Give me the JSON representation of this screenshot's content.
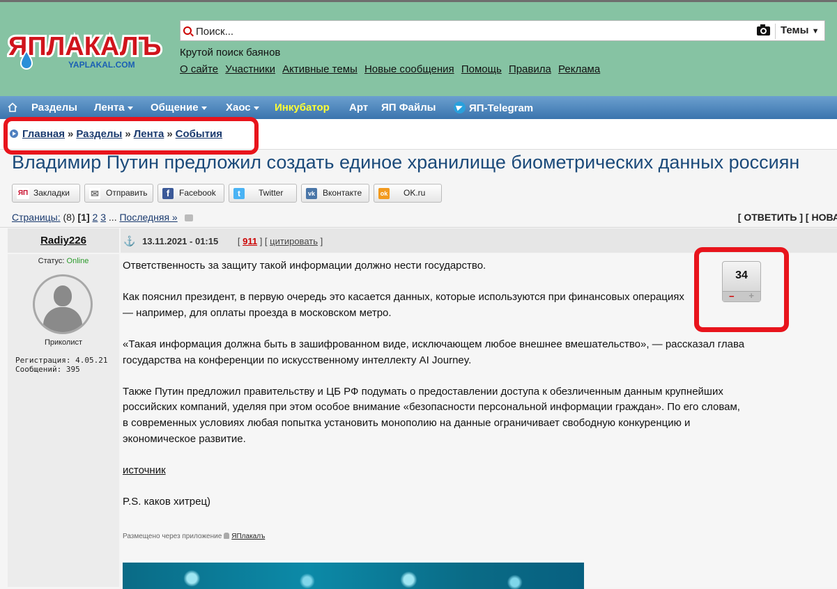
{
  "header": {
    "logo_text": "ЯПЛАКАЛЪ",
    "logo_sub": "YAPLAKAL.COM",
    "search": {
      "placeholder": "Поиск..."
    },
    "themes_label": "Темы",
    "slogan": "Крутой поиск баянов",
    "links": [
      "О сайте",
      "Участники",
      "Активные темы",
      "Новые сообщения",
      "Помощь",
      "Правила",
      "Реклама"
    ]
  },
  "navbar": {
    "items": [
      "Разделы",
      "Лента",
      "Общение",
      "Хаос",
      "Инкубатор",
      "Арт",
      "ЯП Файлы",
      "ЯП-Telegram"
    ],
    "highlight_color": "#ffff33"
  },
  "breadcrumb": {
    "items": [
      "Главная",
      "Разделы",
      "Лента",
      "События"
    ],
    "separator": "»"
  },
  "topic": {
    "title": "Владимир Путин предложил создать единое хранилище биометрических данных россиян"
  },
  "share": {
    "buttons": [
      {
        "label": "Закладки",
        "icon": "yap-bookmark-icon",
        "icon_text": "ЯП",
        "color": "#c8102e"
      },
      {
        "label": "Отправить",
        "icon": "mail-icon",
        "icon_text": "✉",
        "color": "#7a7a7a"
      },
      {
        "label": "Facebook",
        "icon": "facebook-icon",
        "icon_text": "f",
        "color": "#3b5998"
      },
      {
        "label": "Twitter",
        "icon": "twitter-icon",
        "icon_text": "t",
        "color": "#4ab3f4"
      },
      {
        "label": "Вконтакте",
        "icon": "vk-icon",
        "icon_text": "vk",
        "color": "#4a76a8"
      },
      {
        "label": "OK.ru",
        "icon": "ok-icon",
        "icon_text": "ok",
        "color": "#f29a1e"
      }
    ]
  },
  "pages": {
    "label": "Страницы:",
    "count": "(8)",
    "current": "[1]",
    "others": [
      "2",
      "3"
    ],
    "ellipsis": "...",
    "last": "Последняя »",
    "reply": "[ ОТВЕТИТЬ ]",
    "new_topic": "[ НОВА"
  },
  "post": {
    "author": "Radiy226",
    "status_label": "Статус:",
    "status_value": "Online",
    "rank": "Приколист",
    "registration": "Регистрация: 4.05.21",
    "messages": "Сообщений: 395",
    "date": "13.11.2021 - 01:15",
    "rating_link": "911",
    "quote_label": "цитировать",
    "paragraphs": [
      "Ответственность за защиту такой информации должно нести государство.",
      "Как пояснил президент, в первую очередь это касается данных, которые используются при финансовых операциях — например, для оплаты проезда в московском метро.",
      "«Такая информация должна быть в зашифрованном виде, исключающем любое внешнее вмешательство», — рассказал глава государства на конференции по искусственному интеллекту AI Journey.",
      "Также Путин предложил правительству и ЦБ РФ подумать о предоставлении доступа к обезличенным данным крупнейших российских компаний, уделяя при этом особое внимание «безопасности персональной информации граждан». По его словам, в современных условиях любая попытка установить монополию на данные ограничивает свободную конкуренцию и экономическое развитие."
    ],
    "source_link": "источник",
    "ps": "P.S. каков хитрец)",
    "via_text": "Размещено через приложение",
    "via_app": "ЯПлакалъ",
    "vote_count": "34",
    "vote_minus": "−",
    "vote_plus": "+"
  },
  "colors": {
    "header_bg": "#86c3a3",
    "nav_bg": "#3a74ad",
    "highlight_box": "#e8141c",
    "title_color": "#1b4a7a"
  }
}
